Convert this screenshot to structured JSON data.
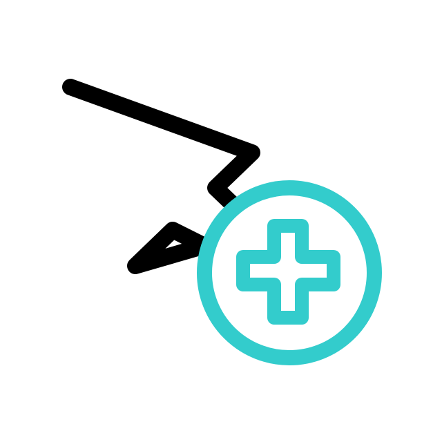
{
  "icon": {
    "name": "cursor-add-icon",
    "parts": [
      "cursor-arrow-icon",
      "plus-circle-icon",
      "plus-icon"
    ]
  },
  "colors": {
    "background": "#ffffff",
    "cursor_stroke": "#000000",
    "accent": "#33cccc"
  }
}
